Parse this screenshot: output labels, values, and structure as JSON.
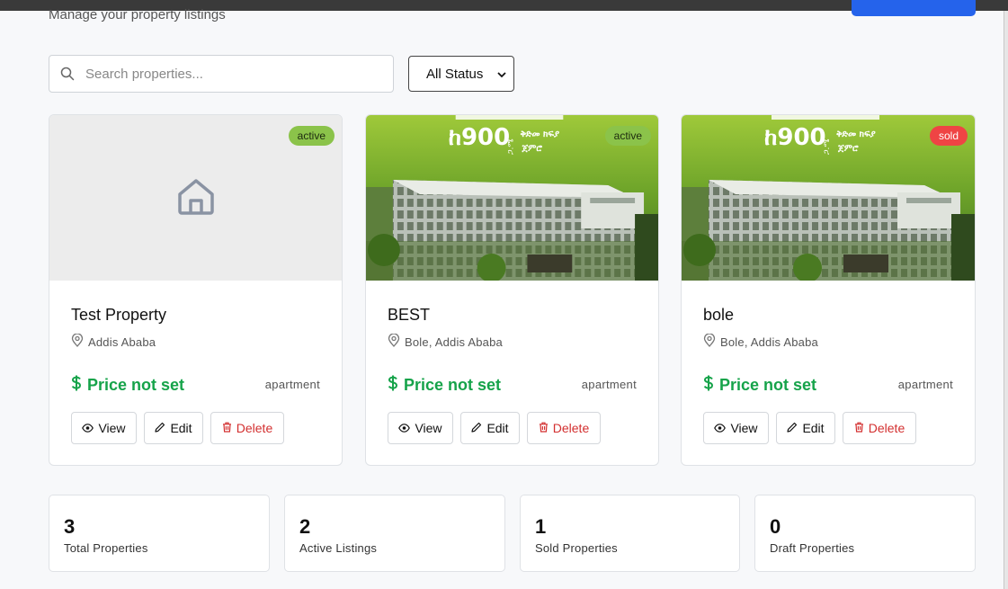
{
  "header": {
    "subtitle": "Manage your property listings"
  },
  "search": {
    "placeholder": "Search properties..."
  },
  "filter": {
    "selected": "All Status"
  },
  "colors": {
    "accent_blue": "#2563eb",
    "price_green": "#16a34a",
    "active_badge": "#8bc34a",
    "sold_badge": "#ef4444",
    "delete_red": "#d32f2f"
  },
  "properties": [
    {
      "title": "Test Property",
      "location": "Addis Ababa",
      "price": "Price not set",
      "type": "apartment",
      "status": "active",
      "image": "placeholder-house-icon"
    },
    {
      "title": "BEST",
      "location": "Bole, Addis Ababa",
      "price": "Price not set",
      "type": "apartment",
      "status": "active",
      "image": "building-advert",
      "image_text": {
        "price": "ከ900",
        "unit": "ጋ.ሜ",
        "line1": "ቅድመ ክፍያ",
        "line2": "ጀምሮ"
      }
    },
    {
      "title": "bole",
      "location": "Bole, Addis Ababa",
      "price": "Price not set",
      "type": "apartment",
      "status": "sold",
      "image": "building-advert",
      "image_text": {
        "price": "ከ900",
        "unit": "ጋ.ሜ",
        "line1": "ቅድመ ክፍያ",
        "line2": "ጀምሮ"
      }
    }
  ],
  "actions": {
    "view": "View",
    "edit": "Edit",
    "delete": "Delete"
  },
  "stats": [
    {
      "value": "3",
      "label": "Total Properties"
    },
    {
      "value": "2",
      "label": "Active Listings"
    },
    {
      "value": "1",
      "label": "Sold Properties"
    },
    {
      "value": "0",
      "label": "Draft Properties"
    }
  ]
}
